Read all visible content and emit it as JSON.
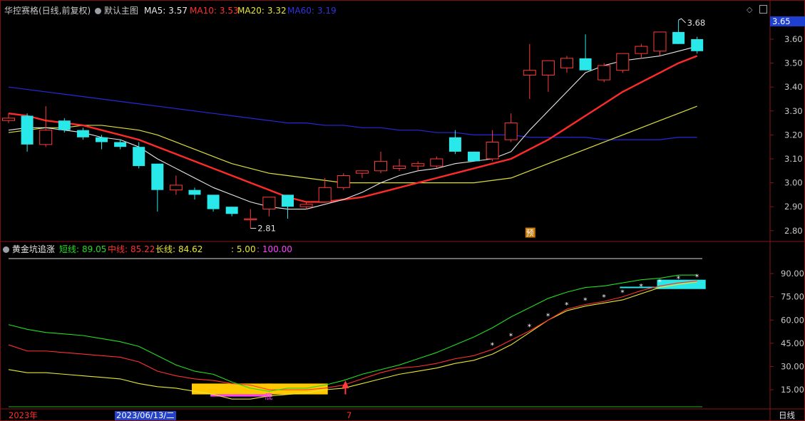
{
  "header": {
    "title": "华控赛格(日线,前复权)",
    "mode": "默认主图",
    "ma5_label": "MA5:",
    "ma5_value": "3.57",
    "ma10_label": "MA10:",
    "ma10_value": "3.53",
    "ma20_label": "MA20:",
    "ma20_value": "3.32",
    "ma60_label": "MA60:",
    "ma60_value": "3.19",
    "last_price": "3.65"
  },
  "indicator": {
    "name": "黄金坑追涨",
    "short_label": "短线:",
    "short_value": "89.05",
    "mid_label": "中线:",
    "mid_value": "85.22",
    "long_label": "长线:",
    "long_value": "84.62",
    "extra1": ": 5.00",
    "extra2": ": 100.00",
    "bottom_mark": "底",
    "star": "*"
  },
  "annotations": {
    "high": "3.68",
    "low": "2.81",
    "yu": "预"
  },
  "footer": {
    "year": "2023年",
    "date": "2023/06/13/二",
    "month_mark": "7",
    "period": "日线"
  },
  "colors": {
    "up": "#ff3b3b",
    "down": "#29e8ea",
    "ma5": "#e8e8e8",
    "ma10": "#ff2a2a",
    "ma20": "#dede3c",
    "ma60": "#2828dc",
    "short": "#22dd22",
    "mid": "#ff3030",
    "long": "#e8e830",
    "gold": "#ffc800",
    "pink": "#ff40ff"
  },
  "chart_data": [
    {
      "type": "candlestick",
      "ylim": [
        2.75,
        3.7
      ],
      "y_ticks": [
        "3.60",
        "3.50",
        "3.40",
        "3.30",
        "3.20",
        "3.10",
        "3.00",
        "2.90",
        "2.80"
      ],
      "candles": [
        {
          "o": 3.26,
          "h": 3.29,
          "l": 3.25,
          "c": 3.27
        },
        {
          "o": 3.28,
          "h": 3.29,
          "l": 3.13,
          "c": 3.16
        },
        {
          "o": 3.16,
          "h": 3.32,
          "l": 3.15,
          "c": 3.22
        },
        {
          "o": 3.26,
          "h": 3.27,
          "l": 3.21,
          "c": 3.22
        },
        {
          "o": 3.22,
          "h": 3.23,
          "l": 3.18,
          "c": 3.19
        },
        {
          "o": 3.19,
          "h": 3.2,
          "l": 3.14,
          "c": 3.17
        },
        {
          "o": 3.17,
          "h": 3.18,
          "l": 3.14,
          "c": 3.15
        },
        {
          "o": 3.15,
          "h": 3.17,
          "l": 3.06,
          "c": 3.07
        },
        {
          "o": 3.08,
          "h": 3.08,
          "l": 2.88,
          "c": 2.97
        },
        {
          "o": 2.97,
          "h": 3.03,
          "l": 2.95,
          "c": 2.99
        },
        {
          "o": 2.97,
          "h": 2.98,
          "l": 2.93,
          "c": 2.95
        },
        {
          "o": 2.95,
          "h": 2.95,
          "l": 2.88,
          "c": 2.89
        },
        {
          "o": 2.9,
          "h": 2.9,
          "l": 2.86,
          "c": 2.87
        },
        {
          "o": 2.85,
          "h": 2.89,
          "l": 2.81,
          "c": 2.85
        },
        {
          "o": 2.89,
          "h": 2.94,
          "l": 2.86,
          "c": 2.94
        },
        {
          "o": 2.95,
          "h": 2.95,
          "l": 2.85,
          "c": 2.9
        },
        {
          "o": 2.9,
          "h": 2.92,
          "l": 2.89,
          "c": 2.91
        },
        {
          "o": 2.92,
          "h": 3.02,
          "l": 2.92,
          "c": 2.98
        },
        {
          "o": 2.98,
          "h": 3.04,
          "l": 2.97,
          "c": 3.03
        },
        {
          "o": 3.04,
          "h": 3.05,
          "l": 3.02,
          "c": 3.05
        },
        {
          "o": 3.05,
          "h": 3.13,
          "l": 3.04,
          "c": 3.09
        },
        {
          "o": 3.06,
          "h": 3.1,
          "l": 3.05,
          "c": 3.07
        },
        {
          "o": 3.07,
          "h": 3.09,
          "l": 3.05,
          "c": 3.08
        },
        {
          "o": 3.07,
          "h": 3.11,
          "l": 3.06,
          "c": 3.1
        },
        {
          "o": 3.19,
          "h": 3.22,
          "l": 3.12,
          "c": 3.13
        },
        {
          "o": 3.13,
          "h": 3.13,
          "l": 3.09,
          "c": 3.09
        },
        {
          "o": 3.1,
          "h": 3.22,
          "l": 3.09,
          "c": 3.17
        },
        {
          "o": 3.18,
          "h": 3.29,
          "l": 3.17,
          "c": 3.25
        },
        {
          "o": 3.45,
          "h": 3.58,
          "l": 3.35,
          "c": 3.47
        },
        {
          "o": 3.45,
          "h": 3.51,
          "l": 3.38,
          "c": 3.51
        },
        {
          "o": 3.48,
          "h": 3.53,
          "l": 3.46,
          "c": 3.52
        },
        {
          "o": 3.52,
          "h": 3.62,
          "l": 3.47,
          "c": 3.47
        },
        {
          "o": 3.43,
          "h": 3.5,
          "l": 3.42,
          "c": 3.49
        },
        {
          "o": 3.47,
          "h": 3.54,
          "l": 3.46,
          "c": 3.54
        },
        {
          "o": 3.54,
          "h": 3.58,
          "l": 3.52,
          "c": 3.57
        },
        {
          "o": 3.55,
          "h": 3.63,
          "l": 3.53,
          "c": 3.63
        },
        {
          "o": 3.63,
          "h": 3.68,
          "l": 3.58,
          "c": 3.58
        },
        {
          "o": 3.6,
          "h": 3.61,
          "l": 3.54,
          "c": 3.55
        }
      ],
      "ma5": [
        3.22,
        3.23,
        3.23,
        3.22,
        3.21,
        3.19,
        3.18,
        3.15,
        3.1,
        3.06,
        3.02,
        2.98,
        2.95,
        2.92,
        2.9,
        2.89,
        2.89,
        2.91,
        2.93,
        2.96,
        3.0,
        3.03,
        3.05,
        3.06,
        3.08,
        3.09,
        3.1,
        3.13,
        3.22,
        3.3,
        3.38,
        3.46,
        3.49,
        3.51,
        3.52,
        3.53,
        3.55,
        3.57
      ],
      "ma10": [
        3.29,
        3.28,
        3.26,
        3.25,
        3.24,
        3.22,
        3.2,
        3.18,
        3.15,
        3.12,
        3.09,
        3.06,
        3.03,
        3.0,
        2.97,
        2.94,
        2.92,
        2.92,
        2.93,
        2.94,
        2.96,
        2.98,
        3.0,
        3.02,
        3.04,
        3.06,
        3.08,
        3.1,
        3.14,
        3.18,
        3.23,
        3.28,
        3.33,
        3.38,
        3.42,
        3.46,
        3.5,
        3.53
      ],
      "ma20": [
        3.21,
        3.22,
        3.23,
        3.23,
        3.24,
        3.24,
        3.23,
        3.22,
        3.2,
        3.17,
        3.14,
        3.11,
        3.08,
        3.06,
        3.04,
        3.03,
        3.02,
        3.01,
        3.0,
        3.0,
        3.0,
        3.0,
        3.0,
        3.0,
        3.0,
        3.0,
        3.01,
        3.02,
        3.05,
        3.08,
        3.11,
        3.14,
        3.17,
        3.2,
        3.23,
        3.26,
        3.29,
        3.32
      ],
      "ma60": [
        3.4,
        3.39,
        3.38,
        3.37,
        3.36,
        3.35,
        3.34,
        3.33,
        3.32,
        3.31,
        3.3,
        3.29,
        3.28,
        3.27,
        3.26,
        3.25,
        3.25,
        3.24,
        3.24,
        3.23,
        3.23,
        3.22,
        3.22,
        3.21,
        3.21,
        3.2,
        3.2,
        3.2,
        3.19,
        3.19,
        3.19,
        3.19,
        3.18,
        3.18,
        3.18,
        3.18,
        3.19,
        3.19
      ]
    },
    {
      "type": "line",
      "title": "黄金坑追涨",
      "ylim": [
        5,
        100
      ],
      "y_ticks": [
        "90.00",
        "75.00",
        "60.00",
        "45.00",
        "30.00",
        "15.00"
      ],
      "series": [
        {
          "name": "短线",
          "values": [
            57,
            54,
            52,
            51,
            50,
            48,
            46,
            43,
            37,
            31,
            27,
            25,
            20,
            16,
            14,
            16,
            16,
            18,
            21,
            25,
            28,
            31,
            35,
            39,
            44,
            49,
            55,
            62,
            68,
            74,
            78,
            81,
            82,
            84,
            86,
            87,
            89,
            89.05
          ]
        },
        {
          "name": "中线",
          "values": [
            44,
            40,
            40,
            39,
            38,
            37,
            36,
            33,
            27,
            24,
            22,
            21,
            19,
            18,
            15,
            15,
            15,
            16,
            18,
            22,
            26,
            29,
            30,
            32,
            35,
            37,
            41,
            47,
            53,
            60,
            67,
            70,
            72,
            75,
            79,
            82,
            84,
            85.22
          ]
        },
        {
          "name": "长线",
          "values": [
            28,
            26,
            26,
            25,
            24,
            23,
            22,
            19,
            17,
            16,
            14,
            12,
            9,
            9,
            11,
            12,
            13,
            15,
            16,
            19,
            22,
            25,
            27,
            29,
            32,
            34,
            38,
            44,
            52,
            60,
            66,
            69,
            71,
            73,
            77,
            81,
            83,
            84.62
          ]
        }
      ]
    }
  ]
}
